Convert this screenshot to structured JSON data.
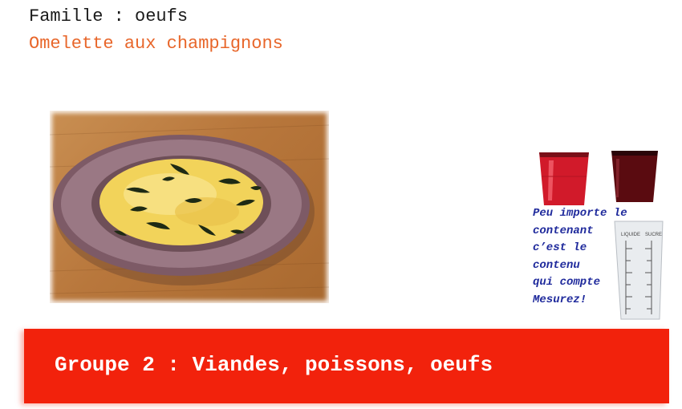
{
  "header": {
    "family": "Famille : oeufs",
    "recipe": "Omelette aux champignons",
    "recipe_color": "#e8662a"
  },
  "photo": {
    "subject": "omelette-plate-image"
  },
  "tip": {
    "lines": [
      "Peu importe le",
      "contenant",
      "c’est le",
      "contenu",
      "qui compte",
      "Mesurez!"
    ],
    "cup_labels": [
      "LIQUIDE",
      "SUCRE"
    ],
    "text_color": "#1f2a9c"
  },
  "banner": {
    "text": "Groupe 2 : Viandes, poissons, oeufs",
    "color": "#f2220c"
  }
}
